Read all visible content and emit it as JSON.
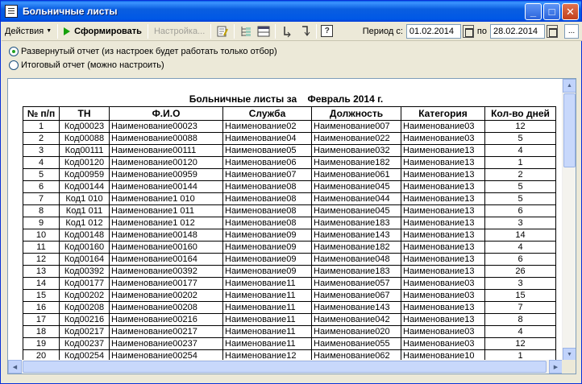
{
  "window": {
    "title": "Больничные листы",
    "minimize": "_",
    "maximize": "□",
    "close": "✕"
  },
  "toolbar": {
    "actions_label": "Действия",
    "generate_label": "Сформировать",
    "settings_label": "Настройка...",
    "help_label": "?",
    "period_label": "Период с:",
    "date_from": "01.02.2014",
    "to_label": "по",
    "date_to": "28.02.2014",
    "more_label": "..."
  },
  "options": {
    "detailed_label": "Развернутый отчет (из настроек будет работать только отбор)",
    "summary_label": "Итоговый отчет (можно настроить)"
  },
  "report": {
    "title": "Больничные листы за    Февраль 2014 г.",
    "columns": [
      "№ п/п",
      "ТН",
      "Ф.И.О",
      "Служба",
      "Должность",
      "Категория",
      "Кол-во дней"
    ],
    "rows": [
      [
        "1",
        "Код00023",
        "Наименование00023",
        "Наименование02",
        "Наименование007",
        "Наименование03",
        "12"
      ],
      [
        "2",
        "Код00088",
        "Наименование00088",
        "Наименование04",
        "Наименование022",
        "Наименование03",
        "5"
      ],
      [
        "3",
        "Код00111",
        "Наименование00111",
        "Наименование05",
        "Наименование032",
        "Наименование13",
        "4"
      ],
      [
        "4",
        "Код00120",
        "Наименование00120",
        "Наименование06",
        "Наименование182",
        "Наименование13",
        "1"
      ],
      [
        "5",
        "Код00959",
        "Наименование00959",
        "Наименование07",
        "Наименование061",
        "Наименование13",
        "2"
      ],
      [
        "6",
        "Код00144",
        "Наименование00144",
        "Наименование08",
        "Наименование045",
        "Наименование13",
        "5"
      ],
      [
        "7",
        "Код1 010",
        "Наименование1 010",
        "Наименование08",
        "Наименование044",
        "Наименование13",
        "5"
      ],
      [
        "8",
        "Код1 011",
        "Наименование1 011",
        "Наименование08",
        "Наименование045",
        "Наименование13",
        "6"
      ],
      [
        "9",
        "Код1 012",
        "Наименование1 012",
        "Наименование08",
        "Наименование183",
        "Наименование13",
        "3"
      ],
      [
        "10",
        "Код00148",
        "Наименование00148",
        "Наименование09",
        "Наименование143",
        "Наименование13",
        "14"
      ],
      [
        "11",
        "Код00160",
        "Наименование00160",
        "Наименование09",
        "Наименование182",
        "Наименование13",
        "4"
      ],
      [
        "12",
        "Код00164",
        "Наименование00164",
        "Наименование09",
        "Наименование048",
        "Наименование13",
        "6"
      ],
      [
        "13",
        "Код00392",
        "Наименование00392",
        "Наименование09",
        "Наименование183",
        "Наименование13",
        "26"
      ],
      [
        "14",
        "Код00177",
        "Наименование00177",
        "Наименование11",
        "Наименование057",
        "Наименование03",
        "3"
      ],
      [
        "15",
        "Код00202",
        "Наименование00202",
        "Наименование11",
        "Наименование067",
        "Наименование03",
        "15"
      ],
      [
        "16",
        "Код00208",
        "Наименование00208",
        "Наименование11",
        "Наименование143",
        "Наименование13",
        "7"
      ],
      [
        "17",
        "Код00216",
        "Наименование00216",
        "Наименование11",
        "Наименование042",
        "Наименование13",
        "8"
      ],
      [
        "18",
        "Код00217",
        "Наименование00217",
        "Наименование11",
        "Наименование020",
        "Наименование03",
        "4"
      ],
      [
        "19",
        "Код00237",
        "Наименование00237",
        "Наименование11",
        "Наименование055",
        "Наименование03",
        "12"
      ],
      [
        "20",
        "Код00254",
        "Наименование00254",
        "Наименование12",
        "Наименование062",
        "Наименование10",
        "1"
      ]
    ]
  }
}
